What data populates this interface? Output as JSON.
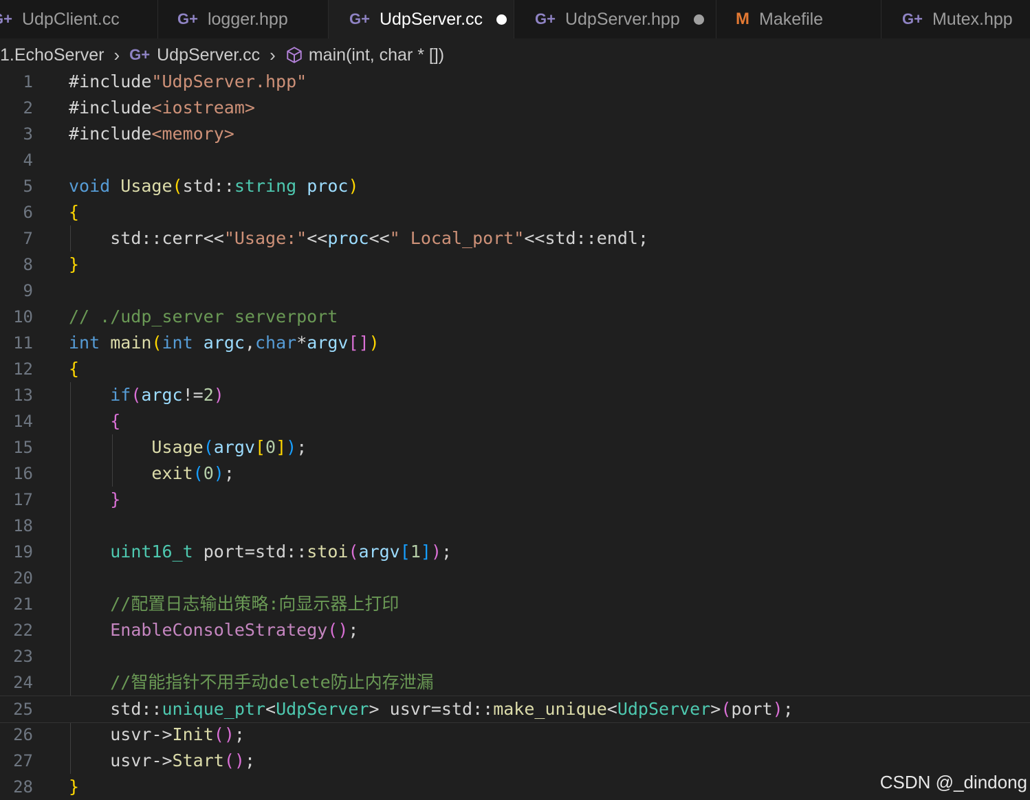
{
  "tabs": [
    {
      "label": "UdpClient.cc",
      "icon": "cpp-file-icon",
      "active": false,
      "modified": false
    },
    {
      "label": "logger.hpp",
      "icon": "cpp-file-icon",
      "active": false,
      "modified": false
    },
    {
      "label": "UdpServer.cc",
      "icon": "cpp-file-icon",
      "active": true,
      "modified": true
    },
    {
      "label": "UdpServer.hpp",
      "icon": "cpp-file-icon",
      "active": false,
      "modified": true
    },
    {
      "label": "Makefile",
      "icon": "makefile-icon",
      "active": false,
      "modified": false
    },
    {
      "label": "Mutex.hpp",
      "icon": "cpp-file-icon",
      "active": false,
      "modified": false
    }
  ],
  "breadcrumb": {
    "folder": "1.EchoServer",
    "file": "UdpServer.cc",
    "symbol": "main(int, char * [])"
  },
  "colors": {
    "keyword": "#569cd6",
    "string": "#ce9178",
    "comment": "#6a9955",
    "function": "#dcdcaa",
    "type": "#4ec9b0",
    "number": "#b5cea8",
    "bracket_gold": "#ffd700",
    "bracket_pink": "#da70d6",
    "bracket_blue": "#179fff"
  },
  "editor": {
    "current_line": 25,
    "lines": [
      {
        "n": "1",
        "t": "#include\"UdpServer.hpp\""
      },
      {
        "n": "2",
        "t": "#include<iostream>"
      },
      {
        "n": "3",
        "t": "#include<memory>"
      },
      {
        "n": "4",
        "t": ""
      },
      {
        "n": "5",
        "t": "void Usage(std::string proc)"
      },
      {
        "n": "6",
        "t": "{"
      },
      {
        "n": "7",
        "t": "    std::cerr<<\"Usage:\"<<proc<<\" Local_port\"<<std::endl;"
      },
      {
        "n": "8",
        "t": "}"
      },
      {
        "n": "9",
        "t": ""
      },
      {
        "n": "10",
        "t": "// ./udp_server serverport"
      },
      {
        "n": "11",
        "t": "int main(int argc,char*argv[])"
      },
      {
        "n": "12",
        "t": "{"
      },
      {
        "n": "13",
        "t": "    if(argc!=2)"
      },
      {
        "n": "14",
        "t": "    {"
      },
      {
        "n": "15",
        "t": "        Usage(argv[0]);"
      },
      {
        "n": "16",
        "t": "        exit(0);"
      },
      {
        "n": "17",
        "t": "    }"
      },
      {
        "n": "18",
        "t": ""
      },
      {
        "n": "19",
        "t": "    uint16_t port=std::stoi(argv[1]);"
      },
      {
        "n": "20",
        "t": ""
      },
      {
        "n": "21",
        "t": "    //配置日志输出策略:向显示器上打印"
      },
      {
        "n": "22",
        "t": "    EnableConsoleStrategy();"
      },
      {
        "n": "23",
        "t": ""
      },
      {
        "n": "24",
        "t": "    //智能指针不用手动delete防止内存泄漏"
      },
      {
        "n": "25",
        "t": "    std::unique_ptr<UdpServer> usvr=std::make_unique<UdpServer>(port);"
      },
      {
        "n": "26",
        "t": "    usvr->Init();"
      },
      {
        "n": "27",
        "t": "    usvr->Start();"
      },
      {
        "n": "28",
        "t": "}"
      }
    ]
  },
  "watermark": "CSDN @_dindong"
}
